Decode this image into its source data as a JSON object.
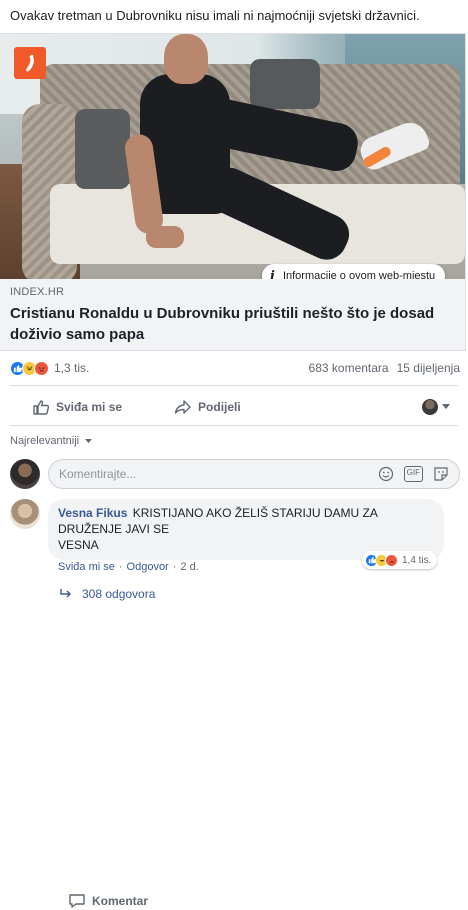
{
  "post": {
    "text": "Ovakav tretman u Dubrovniku nisu imali ni najmoćniji svjetski državnici."
  },
  "link_preview": {
    "logo_icon": "chili-pepper-icon",
    "logo_color": "#f05a28",
    "info_icon": "info-icon",
    "info_label": "Informacije o ovom web-mjestu",
    "domain": "INDEX.HR",
    "headline": "Cristianu Ronaldu u Dubrovniku priuštili nešto što je dosad doživio samo papa"
  },
  "engagement": {
    "reaction_icons": [
      "like-reaction-icon",
      "haha-reaction-icon",
      "angry-reaction-icon"
    ],
    "reaction_count": "1,3 tis.",
    "comments_count": "683 komentara",
    "shares_count": "15 dijeljenja"
  },
  "actions": {
    "like_label": "Sviđa mi se",
    "comment_label": "Komentar",
    "share_label": "Podijeli"
  },
  "comments_section": {
    "sort_label": "Najrelevantniji",
    "input_placeholder": "Komentirajte..."
  },
  "comment": {
    "author": "Vesna Fikus",
    "text": "KRISTIJANO AKO ŽELIŠ STARIJU DAMU ZA DRUŽENJE JAVI SE",
    "text_line2": "VESNA",
    "reaction_count": "1,4 tis.",
    "like_link": "Sviđa mi se",
    "reply_link": "Odgovor",
    "age": "2 d.",
    "replies_label": "308 odgovora"
  },
  "colors": {
    "link_blue": "#385898",
    "facebook_blue": "#1877f2",
    "muted_gray": "#606770"
  }
}
